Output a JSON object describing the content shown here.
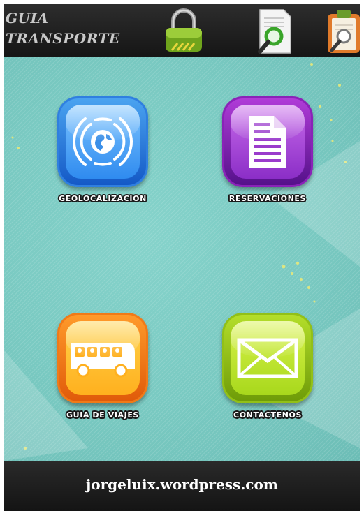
{
  "app": {
    "title_line1": "GUIA",
    "title_line2": "TRANSPORTE"
  },
  "toolbar": {
    "icons": [
      "lock-icon",
      "search-document-icon",
      "clipboard-search-icon"
    ]
  },
  "tiles": [
    {
      "label": "GEOLOCALIZACION",
      "icon": "globe-signal-icon",
      "color": "#2f7fe0"
    },
    {
      "label": "RESERVACIONES",
      "icon": "document-icon",
      "color": "#8a22b8"
    },
    {
      "label": "GUIA DE VIAJES",
      "icon": "bus-icon",
      "color": "#f07a18"
    },
    {
      "label": "CONTACTENOS",
      "icon": "envelope-icon",
      "color": "#92c017"
    }
  ],
  "footer": {
    "text": "jorgeluix.wordpress.com"
  },
  "colors": {
    "background_teal": "#79c9c1",
    "bar_dark": "#1e1e1e"
  }
}
